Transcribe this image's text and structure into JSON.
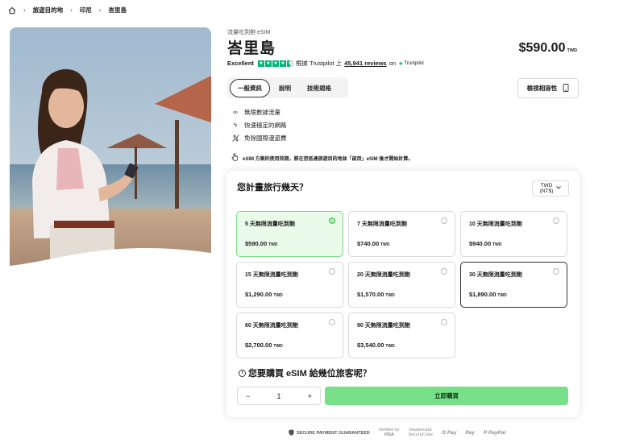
{
  "breadcrumb": {
    "items": [
      "旅遊目的地",
      "印尼",
      "峇里島"
    ],
    "separator": "›"
  },
  "product": {
    "eyebrow": "流量吃到飽 eSIM",
    "title": "峇里島",
    "price": "$590.00",
    "price_currency": "TWD"
  },
  "trustpilot": {
    "rating_label": "Excellent",
    "prefix": "根據 Trustpilot 上",
    "reviews": "45,941 reviews",
    "on": "on",
    "brand": "Trustpilot",
    "stars": 4.5
  },
  "tabs": [
    {
      "label": "一般資訊",
      "active": true
    },
    {
      "label": "說明",
      "active": false
    },
    {
      "label": "技術規格",
      "active": false
    }
  ],
  "compatibility_button": "檢視相容性",
  "features": [
    {
      "icon": "infinity-icon",
      "label": "無限數據流量"
    },
    {
      "icon": "lightning-icon",
      "label": "快速穩定的網路"
    },
    {
      "icon": "no-roaming-icon",
      "label": "免除國際漫遊費"
    }
  ],
  "notice": "eSIM 方案的使用效期，將在您抵達旅遊目的地並「啟用」eSIM 後才開始計算。",
  "planner": {
    "question": "您計畫旅行幾天？",
    "currency_top": "TWD",
    "currency_bottom": "(NT$)",
    "plans": [
      {
        "name": "5 天無限流量吃到飽",
        "price": "$590.00",
        "cur": "TWD",
        "selected": true
      },
      {
        "name": "7 天無限流量吃到飽",
        "price": "$740.00",
        "cur": "TWD",
        "selected": false
      },
      {
        "name": "10 天無限流量吃到飽",
        "price": "$940.00",
        "cur": "TWD",
        "selected": false
      },
      {
        "name": "15 天無限流量吃到飽",
        "price": "$1,290.00",
        "cur": "TWD",
        "selected": false
      },
      {
        "name": "20 天無限流量吃到飽",
        "price": "$1,570.00",
        "cur": "TWD",
        "selected": false
      },
      {
        "name": "30 天無限流量吃到飽",
        "price": "$1,890.00",
        "cur": "TWD",
        "selected": false
      },
      {
        "name": "60 天無限流量吃到飽",
        "price": "$2,700.00",
        "cur": "TWD",
        "selected": false
      },
      {
        "name": "90 天無限流量吃到飽",
        "price": "$3,540.00",
        "cur": "TWD",
        "selected": false
      }
    ],
    "travelers_question": "您要購買 eSIM 給幾位旅客呢？",
    "quantity": "1",
    "minus": "−",
    "plus": "+",
    "buy_label": "立即購買"
  },
  "payments": {
    "secure": "SECURE PAYMENT GUARANTEED",
    "verified_top": "Verified by",
    "verified_bottom": "VISA",
    "mc_top": "Mastercard",
    "mc_bottom": "SecureCode",
    "gpay": "G Pay",
    "applepay": "Pay",
    "paypal": "PayPal"
  },
  "colors": {
    "accent_green": "#78e088",
    "selected_bg": "#eafbea",
    "trustpilot_green": "#00b67a"
  }
}
